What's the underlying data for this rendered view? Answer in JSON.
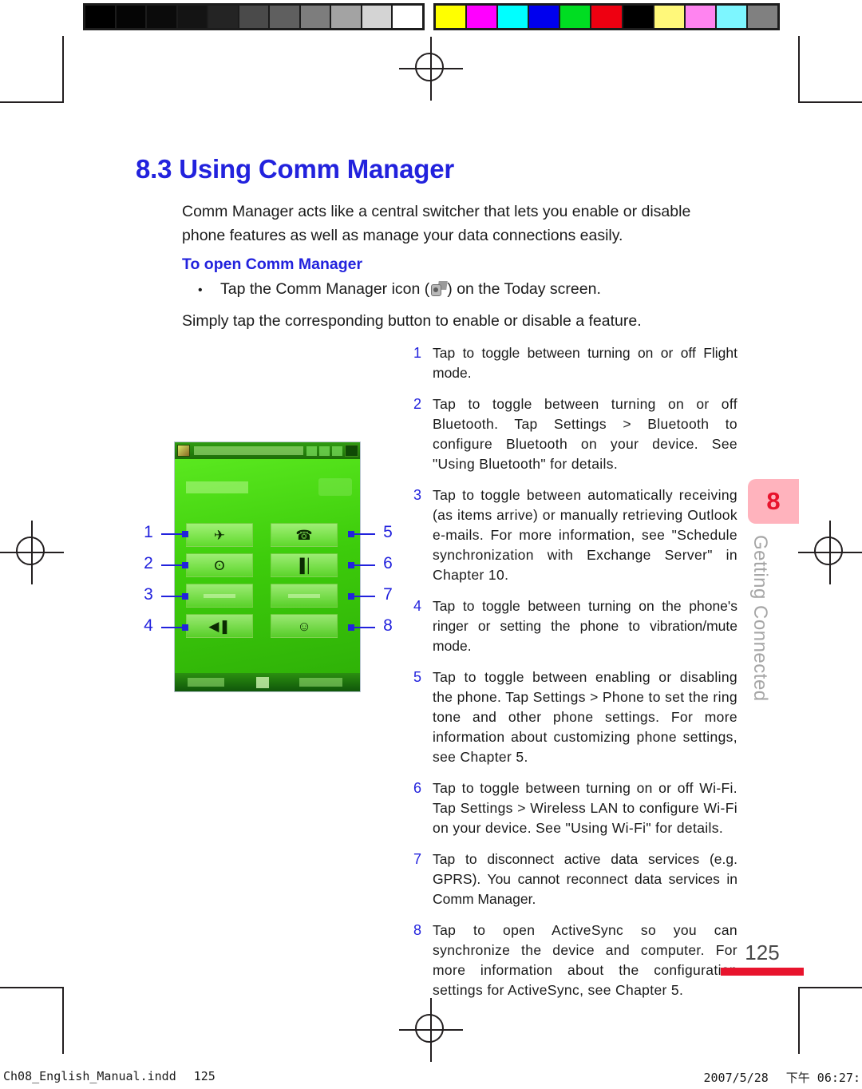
{
  "document": {
    "section_number": "8.3",
    "title": "8.3 Using Comm Manager",
    "intro": "Comm Manager acts like a central switcher that lets you enable or disable phone features as well as manage your data connections easily.",
    "subheading": "To open Comm Manager",
    "bullet": "Tap the Comm Manager icon ( ) on the Today screen.",
    "bullet_prefix": "Tap the Comm Manager icon (",
    "bullet_suffix": ") on the Today screen.",
    "bullet_marker": "•",
    "lead_in": "Simply tap the corresponding button to enable or disable a feature.",
    "page_number": "125"
  },
  "steps": [
    {
      "num": "1",
      "text": "Tap to toggle between turning on or off Flight mode."
    },
    {
      "num": "2",
      "text": "Tap to toggle between turning on or off Bluetooth. Tap Settings > Bluetooth to configure Bluetooth on your device. See \"Using Bluetooth\" for details."
    },
    {
      "num": "3",
      "text": "Tap to toggle between automatically receiving (as items arrive) or manually retrieving Outlook e-mails. For more information, see \"Schedule synchronization with Exchange Server\" in Chapter 10."
    },
    {
      "num": "4",
      "text": "Tap to toggle between turning on the phone's ringer or setting the phone to vibration/mute mode."
    },
    {
      "num": "5",
      "text": "Tap to toggle between enabling or disabling the phone. Tap Settings > Phone to set the ring tone and other phone settings. For more information about customizing phone settings, see Chapter 5."
    },
    {
      "num": "6",
      "text": "Tap to toggle between turning on or off Wi-Fi. Tap Settings > Wireless LAN to configure Wi-Fi on your device. See \"Using Wi-Fi\" for details."
    },
    {
      "num": "7",
      "text": "Tap to disconnect active data services (e.g. GPRS). You cannot reconnect data services in Comm Manager."
    },
    {
      "num": "8",
      "text": "Tap to open ActiveSync so you can synchronize the device and computer. For more information about the configuration settings for ActiveSync, see Chapter 5."
    }
  ],
  "figure": {
    "callouts_left": [
      "1",
      "2",
      "3",
      "4"
    ],
    "callouts_right": [
      "5",
      "6",
      "7",
      "8"
    ],
    "device_buttons": [
      {
        "position": "row1-left",
        "glyph": "✈",
        "callout": "1"
      },
      {
        "position": "row2-left",
        "glyph": "ʘ",
        "callout": "2"
      },
      {
        "position": "row3-left",
        "glyph": "",
        "callout": "3"
      },
      {
        "position": "row4-left",
        "glyph": "◀❚",
        "callout": "4"
      },
      {
        "position": "row1-right",
        "glyph": "☎",
        "callout": "5"
      },
      {
        "position": "row2-right",
        "glyph": "▐│",
        "callout": "6"
      },
      {
        "position": "row3-right",
        "glyph": "",
        "callout": "7"
      },
      {
        "position": "row4-right",
        "glyph": "☺",
        "callout": "8"
      }
    ]
  },
  "chapter_tab": {
    "number": "8",
    "label": "Getting Connected",
    "tab_color": "#ffb3bd",
    "number_color": "#e8142d",
    "label_color": "#a6a6a6"
  },
  "footer": {
    "filename": "Ch08_English_Manual.indd",
    "page": "125",
    "date": "2007/5/28",
    "time": "下午 06:27:"
  },
  "calibration": {
    "grayscale": [
      "#000000",
      "#050505",
      "#0b0b0b",
      "#141414",
      "#242424",
      "#4a4a4a",
      "#5f5f5f",
      "#7d7d7d",
      "#a3a3a3",
      "#d4d4d4",
      "#ffffff"
    ],
    "colors": [
      "#ffff00",
      "#ff00ff",
      "#00ffff",
      "#0000ee",
      "#00dd22",
      "#ee0011",
      "#000000",
      "#fff87a",
      "#ff84f0",
      "#7df6ff",
      "#808080"
    ]
  },
  "theme": {
    "accent_blue": "#2222dd",
    "accent_red": "#e8142d",
    "text": "#1a1a1a"
  }
}
